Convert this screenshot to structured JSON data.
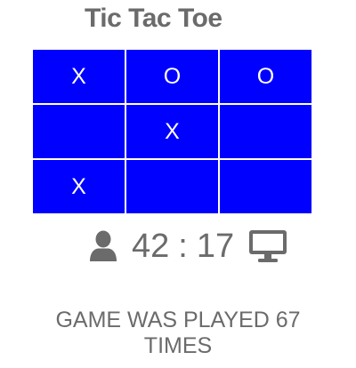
{
  "title": "Tic Tac Toe",
  "colors": {
    "board": "#0000ff",
    "mark": "#ffffff",
    "text": "#6b6b6b"
  },
  "board": {
    "cells": [
      "X",
      "O",
      "O",
      "",
      "X",
      "",
      "X",
      "",
      ""
    ]
  },
  "score": {
    "player_icon": "user-icon",
    "player": "42",
    "separator": ":",
    "computer": "17",
    "computer_icon": "desktop-computer-icon"
  },
  "games_played_text": "GAME WAS PLAYED 67 TIMES"
}
